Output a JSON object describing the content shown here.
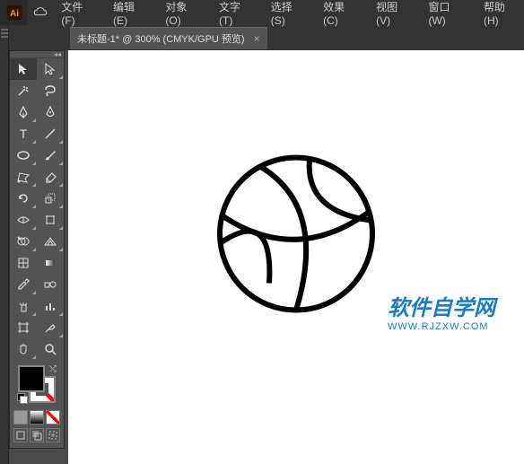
{
  "menu": {
    "file": "文件(F)",
    "edit": "编辑(E)",
    "object": "对象(O)",
    "text": "文字(T)",
    "select": "选择(S)",
    "effect": "效果(C)",
    "view": "视图(V)",
    "window": "窗口(W)",
    "help": "帮助(H)"
  },
  "tab": {
    "title": "未标题-1* @ 300% (CMYK/GPU 预览)",
    "close": "×"
  },
  "watermark": {
    "cn": "软件自学网",
    "en": "WWW.RJZXW.COM"
  },
  "colors": {
    "fill": "#000000",
    "stroke": "none",
    "accent": "#1a7cc9"
  },
  "tools": [
    {
      "id": "selection",
      "label": "selection-tool"
    },
    {
      "id": "direct",
      "label": "direct-selection-tool"
    },
    {
      "id": "wand",
      "label": "magic-wand-tool"
    },
    {
      "id": "lasso",
      "label": "lasso-tool"
    },
    {
      "id": "pen",
      "label": "pen-tool"
    },
    {
      "id": "curve",
      "label": "curvature-tool"
    },
    {
      "id": "type",
      "label": "type-tool"
    },
    {
      "id": "line",
      "label": "line-segment-tool"
    },
    {
      "id": "ellipse",
      "label": "ellipse-tool"
    },
    {
      "id": "brush",
      "label": "paintbrush-tool"
    },
    {
      "id": "shaper",
      "label": "shaper-tool"
    },
    {
      "id": "eraser",
      "label": "eraser-tool"
    },
    {
      "id": "rotate",
      "label": "rotate-tool"
    },
    {
      "id": "scale",
      "label": "scale-tool"
    },
    {
      "id": "width",
      "label": "width-tool"
    },
    {
      "id": "freetrans",
      "label": "free-transform-tool"
    },
    {
      "id": "shapebuild",
      "label": "shape-builder-tool"
    },
    {
      "id": "perspective",
      "label": "perspective-grid-tool"
    },
    {
      "id": "mesh",
      "label": "mesh-tool"
    },
    {
      "id": "gradient",
      "label": "gradient-tool"
    },
    {
      "id": "eyedrop",
      "label": "eyedropper-tool"
    },
    {
      "id": "blend",
      "label": "blend-tool"
    },
    {
      "id": "symbol",
      "label": "symbol-sprayer-tool"
    },
    {
      "id": "graph",
      "label": "column-graph-tool"
    },
    {
      "id": "artboard",
      "label": "artboard-tool"
    },
    {
      "id": "slice",
      "label": "slice-tool"
    },
    {
      "id": "hand",
      "label": "hand-tool"
    },
    {
      "id": "zoom",
      "label": "zoom-tool"
    }
  ]
}
